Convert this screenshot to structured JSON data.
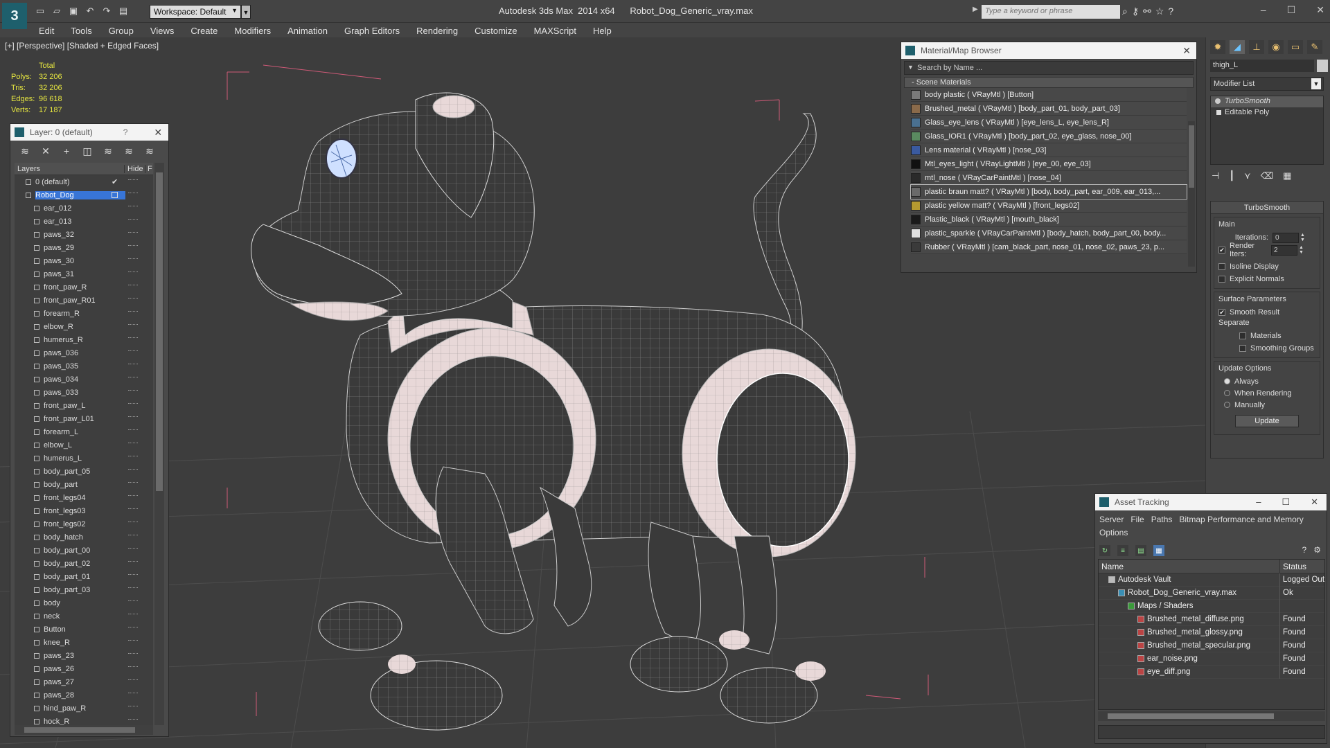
{
  "titlebar": {
    "app_logo": "3",
    "workspace": "Workspace: Default",
    "title": "Autodesk 3ds Max  2014 x64      Robot_Dog_Generic_vray.max",
    "search_placeholder": "Type a keyword or phrase",
    "quick_access_icons": [
      "new-icon",
      "open-icon",
      "save-icon",
      "undo-icon",
      "redo-icon",
      "project-folder-icon"
    ],
    "title_icons": [
      "binoculars-icon",
      "key-icon",
      "network-icon",
      "star-icon",
      "help-icon"
    ]
  },
  "menu": [
    "Edit",
    "Tools",
    "Group",
    "Views",
    "Create",
    "Modifiers",
    "Animation",
    "Graph Editors",
    "Rendering",
    "Customize",
    "MAXScript",
    "Help"
  ],
  "viewport": {
    "label": "[+] [Perspective] [Shaded + Edged Faces]",
    "stats": {
      "total_label": "Total",
      "rows": [
        {
          "k": "Polys:",
          "v": "32 206"
        },
        {
          "k": "Tris:",
          "v": "32 206"
        },
        {
          "k": "Edges:",
          "v": "96 618"
        },
        {
          "k": "Verts:",
          "v": "17 187"
        }
      ]
    }
  },
  "layers": {
    "title": "Layer: 0 (default)",
    "help": "?",
    "close": "✕",
    "tool_icons": [
      "create-layer-icon",
      "delete-layer-icon",
      "add-to-layer-icon",
      "select-objects-icon",
      "select-layer-icon",
      "hide-all-icon",
      "freeze-all-icon"
    ],
    "columns": {
      "name": "Layers",
      "hide": "Hide",
      "freeze": "F"
    },
    "rows": [
      {
        "name": "0 (default)",
        "level": 0,
        "active": true
      },
      {
        "name": "Robot_Dog",
        "level": 0,
        "selected": true
      },
      {
        "name": "ear_012",
        "level": 1
      },
      {
        "name": "ear_013",
        "level": 1
      },
      {
        "name": "paws_32",
        "level": 1
      },
      {
        "name": "paws_29",
        "level": 1
      },
      {
        "name": "paws_30",
        "level": 1
      },
      {
        "name": "paws_31",
        "level": 1
      },
      {
        "name": "front_paw_R",
        "level": 1
      },
      {
        "name": "front_paw_R01",
        "level": 1
      },
      {
        "name": "forearm_R",
        "level": 1
      },
      {
        "name": "elbow_R",
        "level": 1
      },
      {
        "name": "humerus_R",
        "level": 1
      },
      {
        "name": "paws_036",
        "level": 1
      },
      {
        "name": "paws_035",
        "level": 1
      },
      {
        "name": "paws_034",
        "level": 1
      },
      {
        "name": "paws_033",
        "level": 1
      },
      {
        "name": "front_paw_L",
        "level": 1
      },
      {
        "name": "front_paw_L01",
        "level": 1
      },
      {
        "name": "forearm_L",
        "level": 1
      },
      {
        "name": "elbow_L",
        "level": 1
      },
      {
        "name": "humerus_L",
        "level": 1
      },
      {
        "name": "body_part_05",
        "level": 1
      },
      {
        "name": "body_part",
        "level": 1
      },
      {
        "name": "front_legs04",
        "level": 1
      },
      {
        "name": "front_legs03",
        "level": 1
      },
      {
        "name": "front_legs02",
        "level": 1
      },
      {
        "name": "body_hatch",
        "level": 1
      },
      {
        "name": "body_part_00",
        "level": 1
      },
      {
        "name": "body_part_02",
        "level": 1
      },
      {
        "name": "body_part_01",
        "level": 1
      },
      {
        "name": "body_part_03",
        "level": 1
      },
      {
        "name": "body",
        "level": 1
      },
      {
        "name": "neck",
        "level": 1
      },
      {
        "name": "Button",
        "level": 1
      },
      {
        "name": "knee_R",
        "level": 1
      },
      {
        "name": "paws_23",
        "level": 1
      },
      {
        "name": "paws_26",
        "level": 1
      },
      {
        "name": "paws_27",
        "level": 1
      },
      {
        "name": "paws_28",
        "level": 1
      },
      {
        "name": "hind_paw_R",
        "level": 1
      },
      {
        "name": "hock_R",
        "level": 1
      }
    ]
  },
  "material_browser": {
    "title": "Material/Map Browser",
    "close": "✕",
    "search_placeholder": "Search by Name ...",
    "section": "- Scene Materials",
    "items": [
      {
        "label": "body plastic  ( VRayMtl ) [Button]",
        "swatch": "#7a7a7a"
      },
      {
        "label": "Brushed_metal  ( VRayMtl ) [body_part_01, body_part_03]",
        "swatch": "#8a6a4a"
      },
      {
        "label": "Glass_eye_lens  ( VRayMtl ) [eye_lens_L, eye_lens_R]",
        "swatch": "#4a7090"
      },
      {
        "label": "Glass_IOR1  ( VRayMtl ) [body_part_02, eye_glass, nose_00]",
        "swatch": "#5a8a60"
      },
      {
        "label": "Lens material  ( VRayMtl ) [nose_03]",
        "swatch": "#3a5aa0"
      },
      {
        "label": "Mtl_eyes_light  ( VRayLightMtl ) [eye_00, eye_03]",
        "swatch": "#111111"
      },
      {
        "label": "mtl_nose  ( VRayCarPaintMtl ) [nose_04]",
        "swatch": "#2a2a2a"
      },
      {
        "label": "plastic braun matt?  ( VRayMtl ) [body, body_part, ear_009, ear_013,...",
        "swatch": "#6a6a6a",
        "selected": true
      },
      {
        "label": "plastic yellow matt?  ( VRayMtl ) [front_legs02]",
        "swatch": "#b59a30"
      },
      {
        "label": "Plastic_black  ( VRayMtl ) [mouth_black]",
        "swatch": "#1a1a1a"
      },
      {
        "label": "plastic_sparkle  ( VRayCarPaintMtl ) [body_hatch, body_part_00, body...",
        "swatch": "#e0e0e0"
      },
      {
        "label": "Rubber  ( VRayMtl ) [cam_black_part, nose_01, nose_02, paws_23, p...",
        "swatch": "#3a3a3a"
      }
    ]
  },
  "command_panel": {
    "tab_icons": [
      "create-tab-icon",
      "modify-tab-icon",
      "hierarchy-tab-icon",
      "motion-tab-icon",
      "display-tab-icon",
      "utilities-tab-icon"
    ],
    "object_name": "thigh_L",
    "modifier_list": "Modifier List",
    "stack": [
      {
        "label": "TurboSmooth",
        "active": true
      },
      {
        "label": "Editable Poly",
        "active": false
      }
    ],
    "stack_tool_icons": [
      "pin-stack-icon",
      "show-end-result-icon",
      "make-unique-icon",
      "remove-modifier-icon",
      "configure-sets-icon"
    ],
    "rollout_title": "TurboSmooth",
    "main_label": "Main",
    "iterations_label": "Iterations:",
    "iterations_value": "0",
    "render_iters_label": "Render Iters:",
    "render_iters_value": "2",
    "render_iters_checked": "✔",
    "isoline_label": "Isoline Display",
    "explicit_normals_label": "Explicit Normals",
    "surface_label": "Surface Parameters",
    "smooth_result_label": "Smooth Result",
    "smooth_result_checked": "✔",
    "separate_label": "Separate",
    "materials_label": "Materials",
    "smoothing_groups_label": "Smoothing Groups",
    "update_options_label": "Update Options",
    "always_label": "Always",
    "when_rendering_label": "When Rendering",
    "manually_label": "Manually",
    "update_button": "Update"
  },
  "asset_tracking": {
    "title": "Asset Tracking",
    "menu": [
      "Server",
      "File",
      "Paths",
      "Bitmap Performance and Memory",
      "Options"
    ],
    "tool_icons": [
      "refresh-icon",
      "list-view-icon",
      "tree-view-icon",
      "table-view-icon"
    ],
    "columns": {
      "name": "Name",
      "status": "Status"
    },
    "rows": [
      {
        "name": "Autodesk Vault",
        "status": "Logged Out",
        "indent": 1,
        "icon": "vault"
      },
      {
        "name": "Robot_Dog_Generic_vray.max",
        "status": "Ok",
        "indent": 2,
        "icon": "file"
      },
      {
        "name": "Maps / Shaders",
        "status": "",
        "indent": 3,
        "icon": "folder"
      },
      {
        "name": "Brushed_metal_diffuse.png",
        "status": "Found",
        "indent": 4,
        "icon": "png"
      },
      {
        "name": "Brushed_metal_glossy.png",
        "status": "Found",
        "indent": 4,
        "icon": "png"
      },
      {
        "name": "Brushed_metal_specular.png",
        "status": "Found",
        "indent": 4,
        "icon": "png"
      },
      {
        "name": "ear_noise.png",
        "status": "Found",
        "indent": 4,
        "icon": "png"
      },
      {
        "name": "eye_diff.png",
        "status": "Found",
        "indent": 4,
        "icon": "png"
      }
    ]
  },
  "colors": {
    "selection": "#3875d7",
    "stats_text": "#e8e840",
    "viewport_bg": "#3d3d3d",
    "dog_shell": "#3a3a3a",
    "dog_trim": "#d9c4c4",
    "bounding_box": "#d05a78"
  }
}
